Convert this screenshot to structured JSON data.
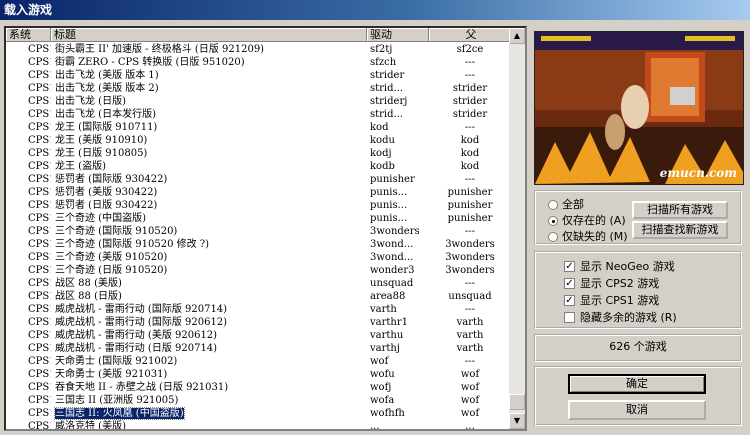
{
  "window": {
    "title": "载入游戏"
  },
  "columns": [
    "系统",
    "标题",
    "驱动",
    "父"
  ],
  "rows": [
    [
      "CPS1",
      "街头霸王 II' 加速版 - 终极格斗 (日版 921209)",
      "sf2tj",
      "sf2ce"
    ],
    [
      "CPS1",
      "街霸 ZERO  - CPS 转换版 (日版 951020)",
      "sfzch",
      "---"
    ],
    [
      "CPS1",
      "出击飞龙 (美版 版本 1)",
      "strider",
      "---"
    ],
    [
      "CPS1",
      "出击飞龙 (美版 版本 2)",
      "strid...",
      "strider"
    ],
    [
      "CPS1",
      "出击飞龙 (日版)",
      "striderj",
      "strider"
    ],
    [
      "CPS1",
      "出击飞龙 (日本发行版)",
      "strid...",
      "strider"
    ],
    [
      "CPS1",
      "龙王 (国际版 910711)",
      "kod",
      "---"
    ],
    [
      "CPS1",
      "龙王 (美版 910910)",
      "kodu",
      "kod"
    ],
    [
      "CPS1",
      "龙王 (日版 910805)",
      "kodj",
      "kod"
    ],
    [
      "CPS1",
      "龙王 (盗版)",
      "kodb",
      "kod"
    ],
    [
      "CPS1",
      "惩罚者 (国际版 930422)",
      "punisher",
      "---"
    ],
    [
      "CPS1",
      "惩罚者 (美版 930422)",
      "punis...",
      "punisher"
    ],
    [
      "CPS1",
      "惩罚者 (日版 930422)",
      "punis...",
      "punisher"
    ],
    [
      "CPS1",
      "三个奇迹 (中国盗版)",
      "punis...",
      "punisher"
    ],
    [
      "CPS1",
      "三个奇迹 (国际版 910520)",
      "3wonders",
      "---"
    ],
    [
      "CPS1",
      "三个奇迹 (国际版 910520 修改 ?)",
      "3wond...",
      "3wonders"
    ],
    [
      "CPS1",
      "三个奇迹 (美版 910520)",
      "3wond...",
      "3wonders"
    ],
    [
      "CPS1",
      "三个奇迹 (日版 910520)",
      "wonder3",
      "3wonders"
    ],
    [
      "CPS1",
      "战区 88 (美版)",
      "unsquad",
      "---"
    ],
    [
      "CPS1",
      "战区 88 (日版)",
      "area88",
      "unsquad"
    ],
    [
      "CPS1",
      "威虎战机 - 雷雨行动 (国际版 920714)",
      "varth",
      "---"
    ],
    [
      "CPS1",
      "威虎战机 - 雷雨行动 (国际版 920612)",
      "varthr1",
      "varth"
    ],
    [
      "CPS1",
      "威虎战机 - 雷雨行动 (美版 920612)",
      "varthu",
      "varth"
    ],
    [
      "CPS1",
      "威虎战机 - 雷雨行动 (日版 920714)",
      "varthj",
      "varth"
    ],
    [
      "CPS1",
      "天命勇士 (国际版 921002)",
      "wof",
      "---"
    ],
    [
      "CPS1",
      "天命勇士 (美版 921031)",
      "wofu",
      "wof"
    ],
    [
      "CPS1",
      "吞食天地 II - 赤壁之战 (日版 921031)",
      "wofj",
      "wof"
    ],
    [
      "CPS1",
      "三国志 II (亚洲版 921005)",
      "wofa",
      "wof"
    ],
    [
      "CPS1",
      "三国志 II: 火凤凰 (中国盗版)",
      "wofhfh",
      "wof"
    ],
    [
      "CPS1",
      "威洛克特 (美版)",
      "...",
      "..."
    ]
  ],
  "selected_row": 28,
  "preview": {
    "watermark": "emucn.com"
  },
  "filter": {
    "options": [
      "全部",
      "仅存在的 (A)",
      "仅缺失的 (M)"
    ],
    "selected": 1,
    "scan_all_label": "扫描所有游戏",
    "scan_new_label": "扫描查找新游戏"
  },
  "display": {
    "options": [
      "显示 NeoGeo 游戏",
      "显示 CPS2 游戏",
      "显示 CPS1 游戏",
      "隐藏多余的游戏 (R)"
    ],
    "checked": [
      true,
      true,
      true,
      false
    ]
  },
  "count_label": "626 个游戏",
  "ok_label": "确定",
  "cancel_label": "取消"
}
